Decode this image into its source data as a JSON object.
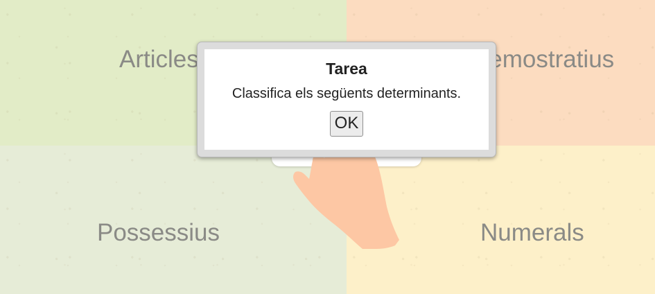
{
  "categories": {
    "top_left": "Articles",
    "top_right": "Demostratius",
    "bottom_left": "Possessius",
    "bottom_right": "Numerals"
  },
  "dialog": {
    "title": "Tarea",
    "message": "Classifica els següents determinants.",
    "ok_label": "OK"
  },
  "icons": {
    "hand": "pointing-hand-icon"
  },
  "colors": {
    "top_left": "#e2ecc7",
    "top_right": "#fcdcc0",
    "bottom_left": "#e6ecd7",
    "bottom_right": "#fdf0c9",
    "hand": "#fdc7a4"
  }
}
